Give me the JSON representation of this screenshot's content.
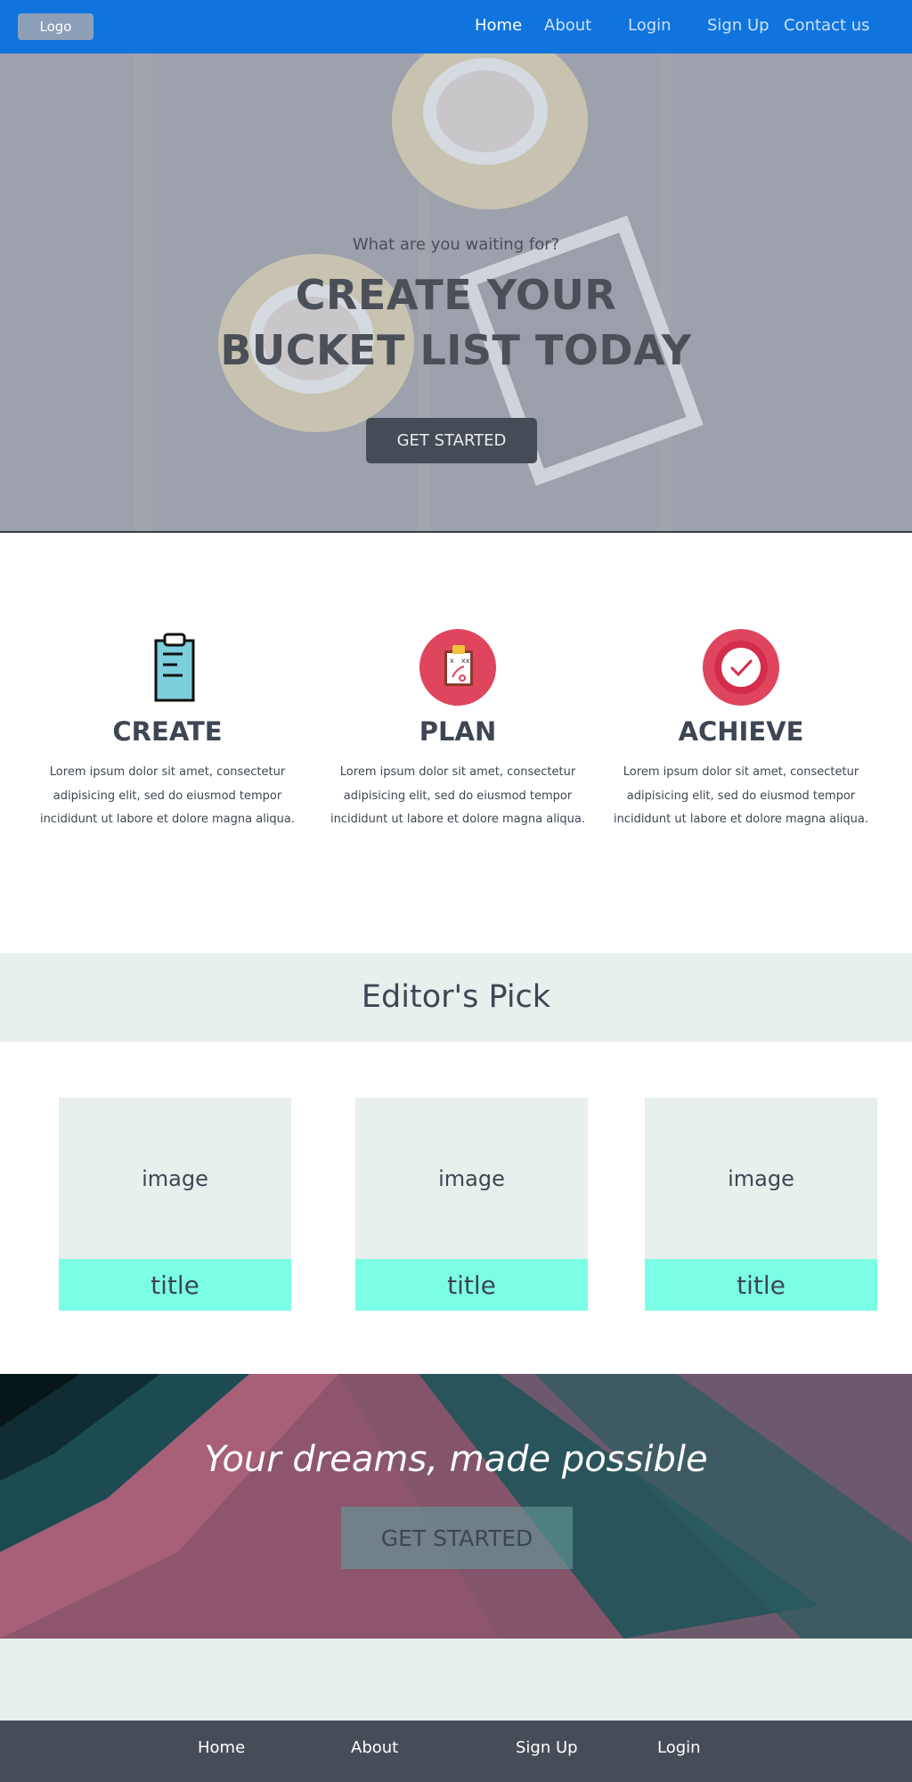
{
  "nav": {
    "logo": "Logo",
    "links": [
      "Home",
      "About",
      "Login",
      "Sign Up",
      "Contact us"
    ]
  },
  "hero": {
    "subtitle": "What are you waiting for?",
    "title_line1": "CREATE YOUR",
    "title_line2": "BUCKET LIST TODAY",
    "button": "GET STARTED"
  },
  "features": [
    {
      "title": "CREATE",
      "icon": "clipboard-icon",
      "text": "Lorem ipsum dolor sit amet, consectetur adipisicing elit, sed do eiusmod tempor incididunt ut labore et dolore magna aliqua."
    },
    {
      "title": "PLAN",
      "icon": "strategy-board-icon",
      "text": "Lorem ipsum dolor sit amet, consectetur adipisicing elit, sed do eiusmod tempor incididunt ut labore et dolore magna aliqua."
    },
    {
      "title": "ACHIEVE",
      "icon": "checkmark-badge-icon",
      "text": "Lorem ipsum dolor sit amet, consectetur adipisicing elit, sed do eiusmod tempor incididunt ut labore et dolore magna aliqua."
    }
  ],
  "editors_pick": {
    "heading": "Editor's Pick",
    "cards": [
      {
        "image": "image",
        "title": "title"
      },
      {
        "image": "image",
        "title": "title"
      },
      {
        "image": "image",
        "title": "title"
      }
    ]
  },
  "dream": {
    "text": "Your dreams, made possible",
    "button": "GET STARTED"
  },
  "footer": {
    "links": [
      "Home",
      "About",
      "Sign Up",
      "Login"
    ]
  },
  "colors": {
    "nav": "#0f74de",
    "footer": "#474d57",
    "accent_card_title": "#7bfee5",
    "pale_green": "#e7f0ec",
    "red_icon": "#e0455e"
  }
}
